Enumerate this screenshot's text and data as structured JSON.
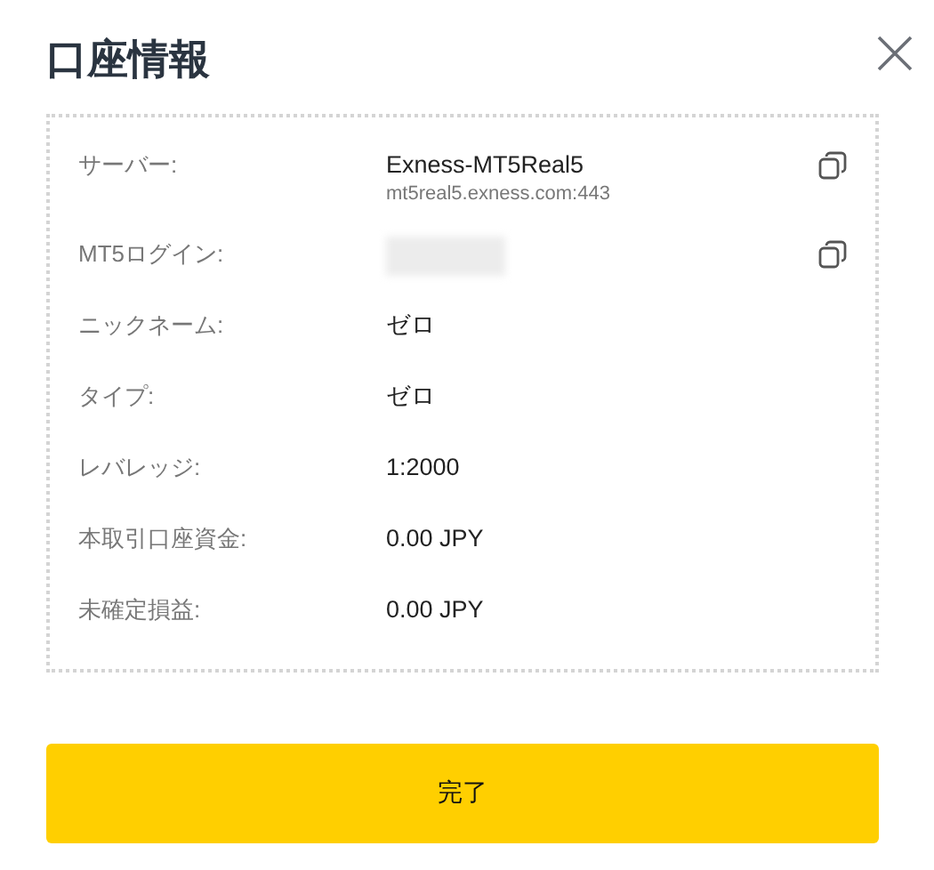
{
  "title": "口座情報",
  "rows": [
    {
      "label": "サーバー:",
      "value": "Exness-MT5Real5",
      "sub": "mt5real5.exness.com:443",
      "copy": true,
      "redacted": false
    },
    {
      "label": "MT5ログイン:",
      "copy": true,
      "redacted": true
    },
    {
      "label": "ニックネーム:",
      "value": "ゼロ",
      "copy": false,
      "redacted": false
    },
    {
      "label": "タイプ:",
      "value": "ゼロ",
      "copy": false,
      "redacted": false
    },
    {
      "label": "レバレッジ:",
      "value": "1:2000",
      "copy": false,
      "redacted": false
    },
    {
      "label": "本取引口座資金:",
      "value": "0.00 JPY",
      "copy": false,
      "redacted": false
    },
    {
      "label": "未確定損益:",
      "value": "0.00 JPY",
      "copy": false,
      "redacted": false
    }
  ],
  "button": "完了"
}
